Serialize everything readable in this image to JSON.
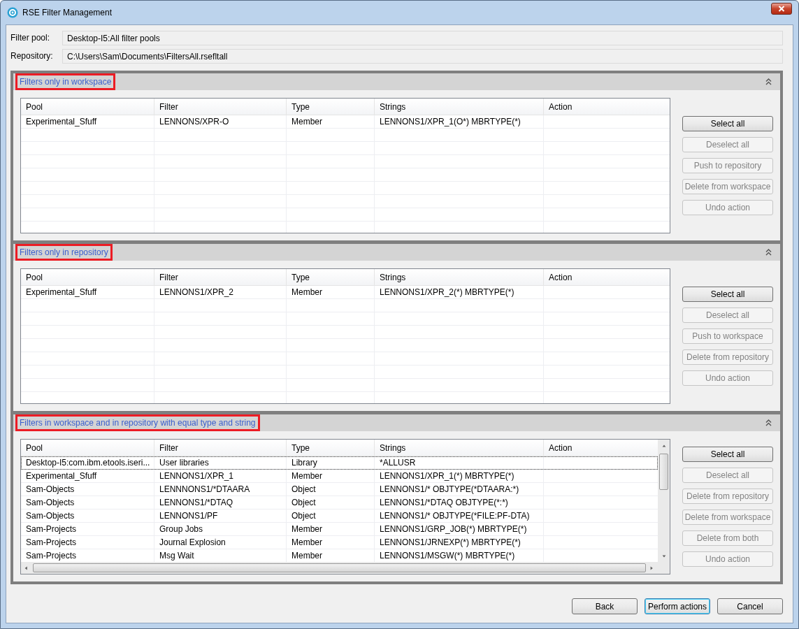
{
  "window": {
    "title": "RSE Filter Management"
  },
  "fields": [
    {
      "label": "Filter pool:",
      "value": "Desktop-I5:All filter pools"
    },
    {
      "label": "Repository:",
      "value": "C:\\Users\\Sam\\Documents\\FiltersAll.rsefltall"
    }
  ],
  "sections": [
    {
      "title": "Filters only in workspace",
      "highlighted": true,
      "table": {
        "columns": [
          "Pool",
          "Filter",
          "Type",
          "Strings",
          "Action"
        ],
        "scrollable": false,
        "rows": [
          {
            "cells": [
              "Experimental_Sfuff",
              "LENNONS/XPR-O",
              "Member",
              "LENNONS1/XPR_1(O*) MBRTYPE(*)"
            ],
            "focused": false
          }
        ]
      },
      "buttons": [
        {
          "label": "Select all",
          "disabled": false
        },
        {
          "label": "Deselect all",
          "disabled": true
        },
        {
          "label": "Push to repository",
          "disabled": true
        },
        {
          "label": "Delete from workspace",
          "disabled": true
        },
        {
          "label": "Undo action",
          "disabled": true
        }
      ]
    },
    {
      "title": "Filters only in repository",
      "highlighted": true,
      "table": {
        "columns": [
          "Pool",
          "Filter",
          "Type",
          "Strings",
          "Action"
        ],
        "scrollable": false,
        "rows": [
          {
            "cells": [
              "Experimental_Sfuff",
              "LENNONS1/XPR_2",
              "Member",
              "LENNONS1/XPR_2(*) MBRTYPE(*)"
            ],
            "focused": false
          }
        ]
      },
      "buttons": [
        {
          "label": "Select all",
          "disabled": false
        },
        {
          "label": "Deselect all",
          "disabled": true
        },
        {
          "label": "Push to workspace",
          "disabled": true
        },
        {
          "label": "Delete from repository",
          "disabled": true
        },
        {
          "label": "Undo action",
          "disabled": true
        }
      ]
    },
    {
      "title": "Filters in workspace and in repository with equal type and string",
      "highlighted": true,
      "table": {
        "columns": [
          "Pool",
          "Filter",
          "Type",
          "Strings",
          "Action"
        ],
        "scrollable": true,
        "rows": [
          {
            "cells": [
              "Desktop-I5:com.ibm.etools.iseri...",
              "User libraries",
              "Library",
              "*ALLUSR"
            ],
            "focused": true
          },
          {
            "cells": [
              "Experimental_Sfuff",
              "LENNONS1/XPR_1",
              "Member",
              "LENNONS1/XPR_1(*) MBRTYPE(*)"
            ],
            "focused": false
          },
          {
            "cells": [
              "Sam-Objects",
              "LENNNONS1/*DTAARA",
              "Object",
              "LENNONS1/* OBJTYPE(*DTAARA:*)"
            ],
            "focused": false
          },
          {
            "cells": [
              "Sam-Objects",
              "LENNONS1/*DTAQ",
              "Object",
              "LENNONS1/*DTAQ OBJTYPE(*:*)"
            ],
            "focused": false
          },
          {
            "cells": [
              "Sam-Objects",
              "LENNONS1/PF",
              "Object",
              "LENNONS1/* OBJTYPE(*FILE:PF-DTA)"
            ],
            "focused": false
          },
          {
            "cells": [
              "Sam-Projects",
              "Group Jobs",
              "Member",
              "LENNONS1/GRP_JOB(*) MBRTYPE(*)"
            ],
            "focused": false
          },
          {
            "cells": [
              "Sam-Projects",
              "Journal Explosion",
              "Member",
              "LENNONS1/JRNEXP(*) MBRTYPE(*)"
            ],
            "focused": false
          },
          {
            "cells": [
              "Sam-Projects",
              "Msg Wait",
              "Member",
              "LENNONS1/MSGW(*) MBRTYPE(*)"
            ],
            "focused": false
          }
        ]
      },
      "buttons": [
        {
          "label": "Select all",
          "disabled": false
        },
        {
          "label": "Deselect all",
          "disabled": true
        },
        {
          "label": "Delete from repository",
          "disabled": true
        },
        {
          "label": "Delete from workspace",
          "disabled": true
        },
        {
          "label": "Delete from both",
          "disabled": true
        },
        {
          "label": "Undo action",
          "disabled": true
        }
      ]
    }
  ],
  "dialog_buttons": [
    {
      "label": "Back",
      "default": false
    },
    {
      "label": "Perform actions",
      "default": true
    },
    {
      "label": "Cancel",
      "default": false
    }
  ]
}
